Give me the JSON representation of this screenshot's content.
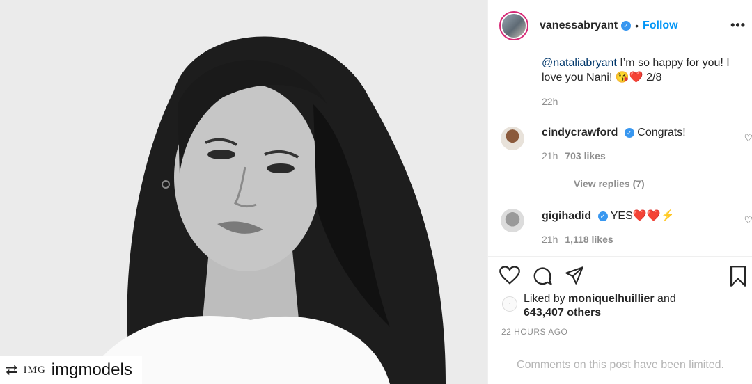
{
  "watermark": {
    "repost_icon": "repost-icon",
    "brand": "IMG",
    "account": "imgmodels"
  },
  "header": {
    "username": "vanessabryant",
    "separator": "•",
    "follow_label": "Follow",
    "more_label": "•••"
  },
  "caption": {
    "mention": "@nataliabryant",
    "text": " I’m so happy for you! I love you Nani! 😘❤️ 2/8",
    "time": "22h"
  },
  "comments": [
    {
      "user": "cindycrawford",
      "text": "Congrats!",
      "time": "21h",
      "likes": "703 likes"
    },
    {
      "user": "gigihadid",
      "text": "YES❤️❤️⚡",
      "time": "21h",
      "likes": "1,118 likes"
    }
  ],
  "replies_label": "View replies (7)",
  "likes": {
    "prefix": "Liked by ",
    "user": "moniquelhuillier",
    "middle": " and",
    "count": "643,407 others"
  },
  "timestamp": "22 HOURS AGO",
  "limited_text": "Comments on this post have been limited.",
  "icons": {
    "like": "heart-icon",
    "comment": "comment-icon",
    "share": "share-icon",
    "save": "bookmark-icon"
  },
  "colors": {
    "accent": "#0095f6",
    "verified": "#3897f0",
    "mention": "#00376b"
  }
}
